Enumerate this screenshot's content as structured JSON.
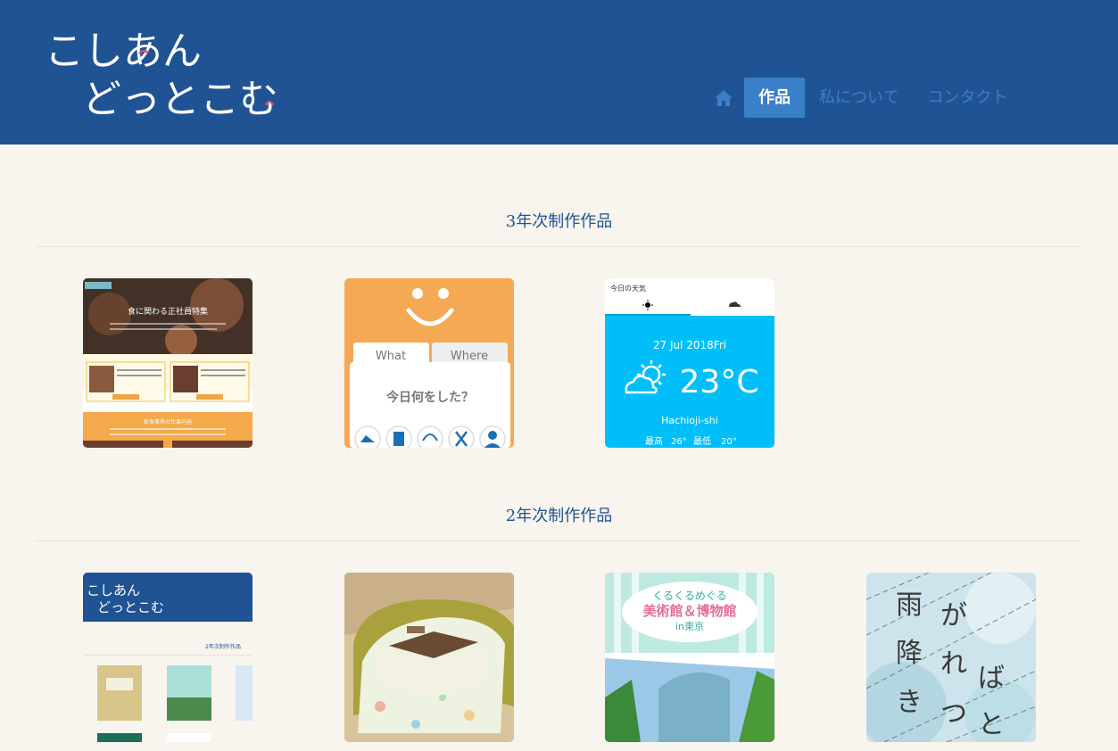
{
  "header": {
    "logo_line1": "こしあん",
    "logo_line2": "どっとこむ",
    "colors": {
      "bar": "#1f5393",
      "active": "#3a7fc8",
      "link": "#3a7fc8"
    }
  },
  "nav": {
    "home_icon": "home-icon",
    "items": [
      {
        "label": "作品",
        "active": true
      },
      {
        "label": "私について",
        "active": false
      },
      {
        "label": "コンタクト",
        "active": false
      }
    ]
  },
  "sections": [
    {
      "title": "3年次制作作品",
      "works": [
        {
          "name": "recruit-site",
          "heading": "食に関わる正社員特集",
          "band": "飲食業界の仕事内容"
        },
        {
          "name": "diary-app",
          "tab1": "What",
          "tab2": "Where",
          "question": "今日何をした？"
        },
        {
          "name": "weather-app",
          "header": "今日の天気",
          "date": "27 Jul 2018Fri",
          "temp": "23°C",
          "city": "Hachioji-shi",
          "high_label": "最高",
          "high": "26°",
          "low_label": "最低",
          "low": "20°"
        }
      ]
    },
    {
      "title": "2年次制作作品",
      "works": [
        {
          "name": "portfolio-site",
          "logo_line1": "こしあん",
          "logo_line2": "どっとこむ",
          "caption": "2年次制作作品"
        },
        {
          "name": "kotatsu-render"
        },
        {
          "name": "museum-guide",
          "line1": "くるくるめぐる",
          "line2": "美術館＆博物館",
          "line3": "in東京"
        },
        {
          "name": "rain-poem",
          "c1": "雨",
          "c2": "降",
          "c3": "き",
          "c4": "が",
          "c5": "れ",
          "c6": "つ",
          "c7": "ば",
          "c8": "と"
        }
      ]
    }
  ]
}
